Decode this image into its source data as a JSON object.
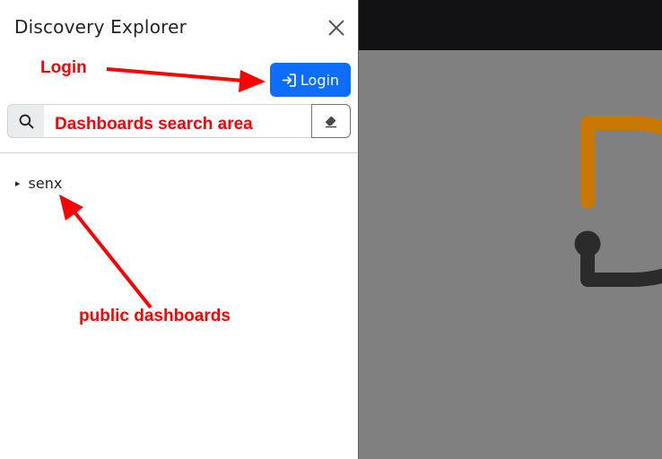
{
  "panel": {
    "title": "Discovery Explorer",
    "close_icon": "close-icon"
  },
  "login_button": {
    "label": "Login",
    "icon": "login-icon",
    "color": "#0d6efd"
  },
  "search": {
    "icon": "search-icon",
    "clear_icon": "eraser-icon",
    "value": "",
    "placeholder": ""
  },
  "tree": {
    "items": [
      {
        "label": "senx",
        "caret": "▸"
      }
    ]
  },
  "annotations": {
    "login": "Login",
    "search_area": "Dashboards search area",
    "public_dashboards": "public dashboards",
    "color": "#ff0000"
  },
  "preview": {
    "header_color": "#121214",
    "body_color": "#808080",
    "logo_icon": "discovery-logo-icon"
  }
}
